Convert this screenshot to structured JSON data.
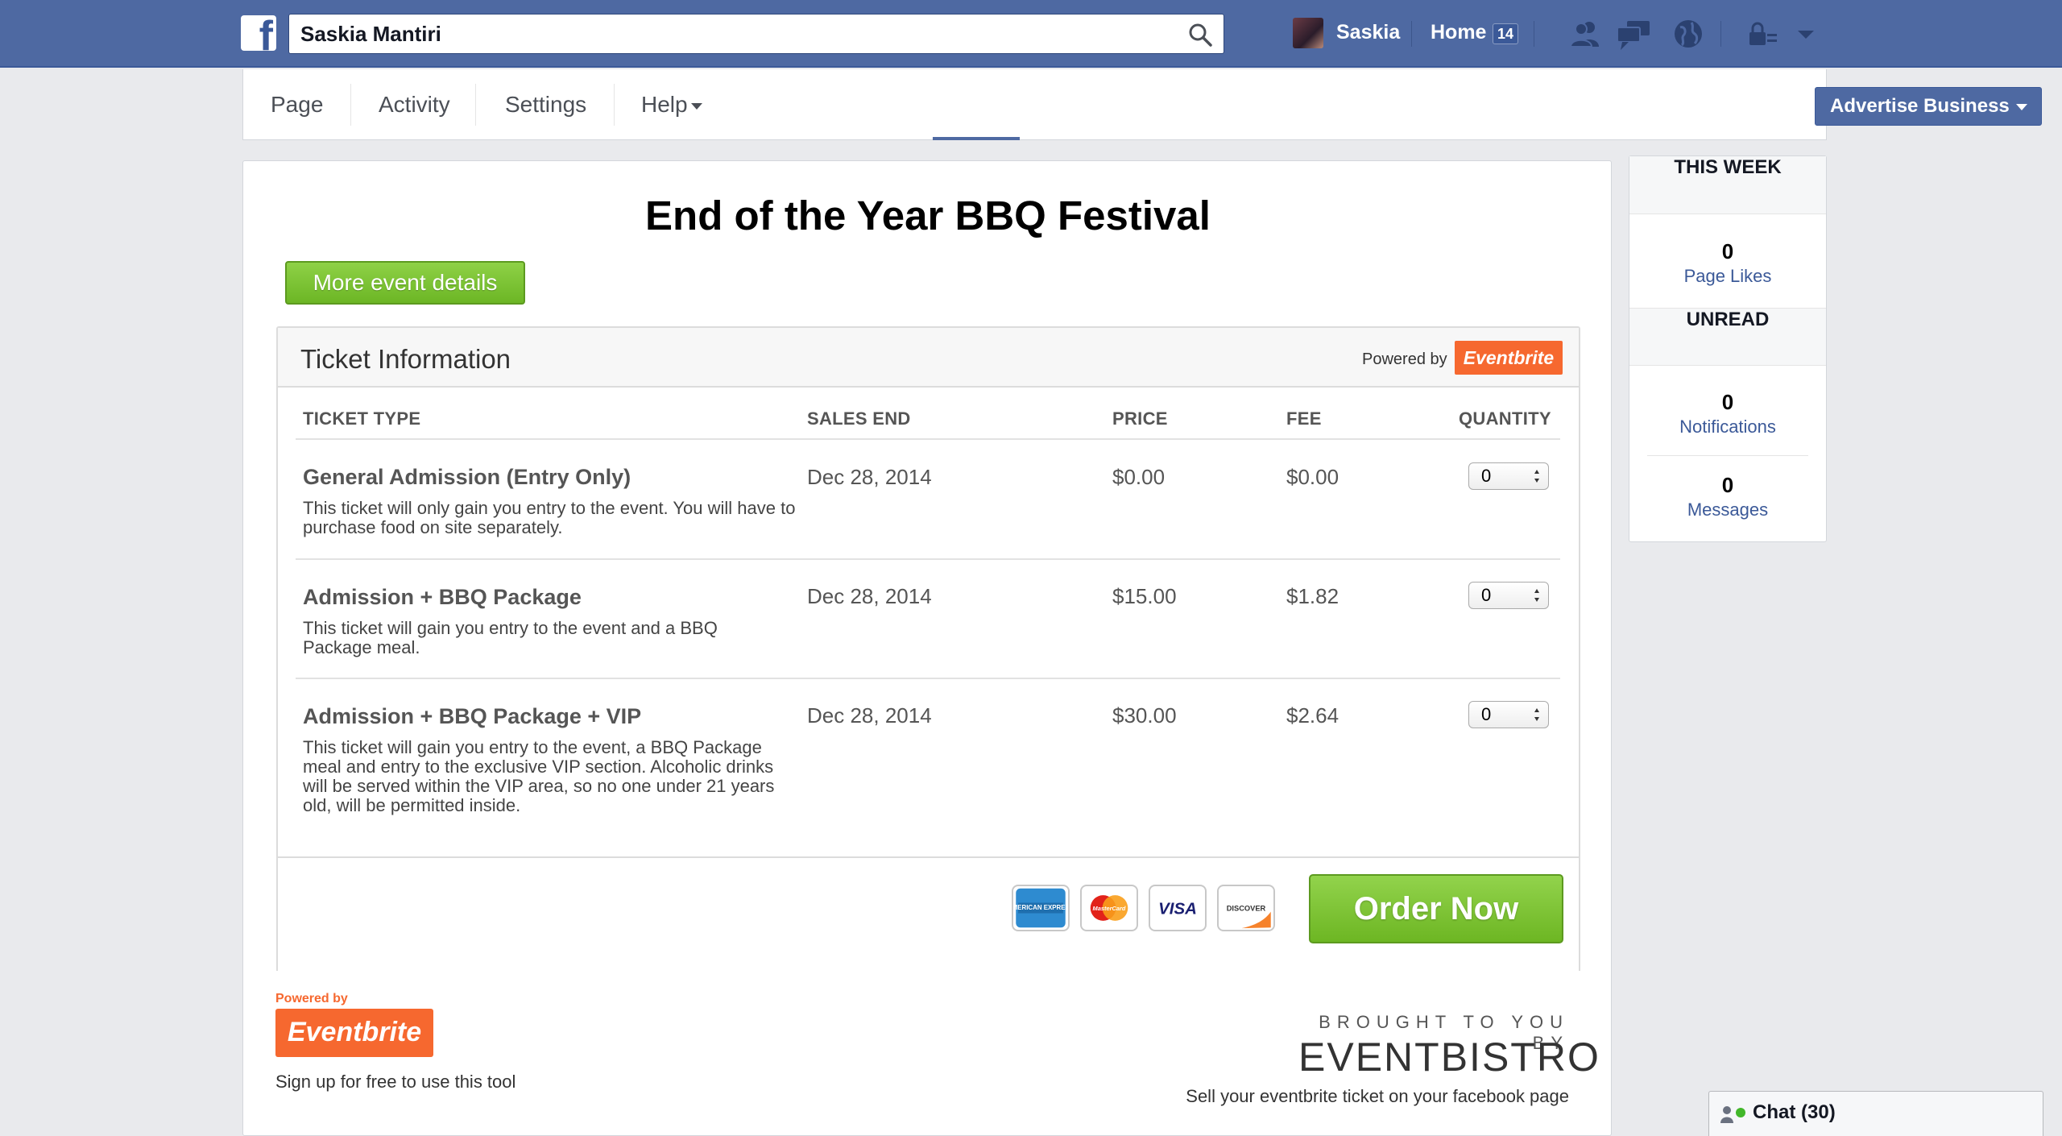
{
  "topbar": {
    "logo_letter": "f",
    "search_value": "Saskia Mantiri",
    "user_name": "Saskia",
    "home_label": "Home",
    "home_count": "14",
    "colors": {
      "bar": "#4e69a2",
      "bar_dark": "#3b5998"
    }
  },
  "pagebar": {
    "tabs": [
      {
        "label": "Page"
      },
      {
        "label": "Activity"
      },
      {
        "label": "Settings"
      },
      {
        "label": "Help"
      }
    ],
    "advertise_label": "Advertise Business"
  },
  "event": {
    "title": "End of the Year BBQ Festival",
    "more_details_label": "More event details",
    "ticket_info_title": "Ticket Information",
    "powered_by": "Powered by",
    "eventbrite_logo": "Eventbrite",
    "columns": [
      "TICKET TYPE",
      "SALES END",
      "PRICE",
      "FEE",
      "QUANTITY"
    ],
    "tickets": [
      {
        "name": "General Admission (Entry Only)",
        "description": "This ticket will only gain you entry to the event. You will have to purchase food on site separately.",
        "sales_end": "Dec 28, 2014",
        "price": "$0.00",
        "fee": "$0.00",
        "quantity": "0"
      },
      {
        "name": "Admission + BBQ Package",
        "description": "This ticket will gain you entry to the event and a BBQ Package meal.",
        "sales_end": "Dec 28, 2014",
        "price": "$15.00",
        "fee": "$1.82",
        "quantity": "0"
      },
      {
        "name": "Admission + BBQ Package + VIP",
        "description": "This ticket will gain you entry to the event, a BBQ Package meal and entry to the exclusive VIP section. Alcoholic drinks will be served within the VIP area, so no one under 21 years old, will be permitted inside.",
        "sales_end": "Dec 28, 2014",
        "price": "$30.00",
        "fee": "$2.64",
        "quantity": "0"
      }
    ],
    "payment_cards": [
      {
        "name": "american-express",
        "label": "AMERICAN EXPRESS"
      },
      {
        "name": "mastercard",
        "label": "MasterCard"
      },
      {
        "name": "visa",
        "label": "VISA"
      },
      {
        "name": "discover",
        "label": "DISCOVER"
      }
    ],
    "order_label": "Order Now",
    "colors": {
      "green": "#7cc436",
      "eventbrite_orange": "#f6682f"
    }
  },
  "footer": {
    "powered_by": "Powered by",
    "eventbrite_logo": "Eventbrite",
    "signup_text": "Sign up for free to use this tool",
    "brought_text": "BROUGHT TO YOU BY",
    "bistro_logo": "EVENTBISTRO",
    "sell_text": "Sell your eventbrite ticket on your facebook page"
  },
  "sidebar": {
    "this_week_title": "THIS WEEK",
    "page_likes_count": "0",
    "page_likes_label": "Page Likes",
    "unread_title": "UNREAD",
    "notifications_count": "0",
    "notifications_label": "Notifications",
    "messages_count": "0",
    "messages_label": "Messages"
  },
  "chat": {
    "label": "Chat (30)"
  }
}
